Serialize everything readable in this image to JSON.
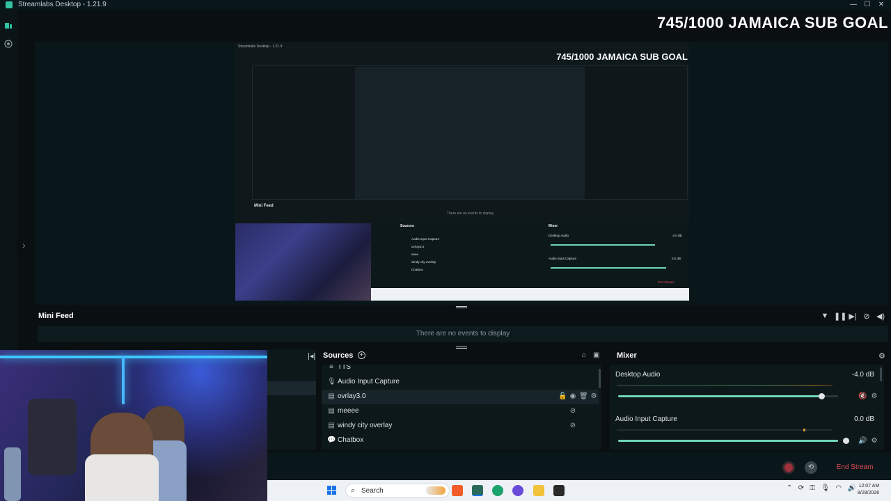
{
  "window": {
    "title": "Streamlabs Desktop - 1.21.9",
    "minimize": "—",
    "maximize": "☐",
    "close": "✕"
  },
  "overlay": {
    "goal_text": "745/1000 JAMAICA SUB GOAL"
  },
  "inner_preview": {
    "title": "Streamlabs Desktop - 1.21.9",
    "goal_text": "745/1000 JAMAICA SUB GOAL",
    "mini_feed_title": "Mini Feed",
    "mini_feed_empty": "There are no events to display",
    "sources_title": "Sources",
    "mixer_title": "Mixer",
    "sources": [
      "Audio Input Capture",
      "ovrlay3.0",
      "eeee",
      "windy city overlay",
      "Chatbox"
    ],
    "mixer": [
      {
        "name": "Desktop Audio",
        "db": "-4.0 dB"
      },
      {
        "name": "Audio Input Capture",
        "db": "0.0 dB"
      }
    ],
    "end_stream": "End Stream"
  },
  "mini_feed": {
    "title": "Mini Feed",
    "empty_text": "There are no events to display",
    "icons": [
      "filter-icon",
      "pause-icon",
      "skip-icon",
      "mute-alerts-icon",
      "volume-icon"
    ]
  },
  "sources": {
    "title": "Sources",
    "items": [
      {
        "label": "TTS",
        "icon": "text-icon"
      },
      {
        "label": "Audio Input Capture",
        "icon": "microphone-icon"
      },
      {
        "label": "ovrlay3.0",
        "icon": "browser-source-icon"
      },
      {
        "label": "meeee",
        "icon": "browser-source-icon"
      },
      {
        "label": "windy city overlay",
        "icon": "browser-source-icon"
      },
      {
        "label": "Chatbox",
        "icon": "chat-icon"
      }
    ]
  },
  "mixer": {
    "title": "Mixer",
    "channels": [
      {
        "name": "Desktop Audio",
        "db": "-4.0 dB",
        "level": 0.92
      },
      {
        "name": "Audio Input Capture",
        "db": "0.0 dB",
        "level": 1.0
      }
    ]
  },
  "controls": {
    "end_stream": "End Stream"
  },
  "taskbar": {
    "search_placeholder": "Search",
    "time": "12:07 AM",
    "date": "8/28/2026"
  },
  "colors": {
    "accent": "#31c3a2",
    "end_stream": "#e24b55",
    "panel": "#0d181b",
    "background": "#09161a"
  }
}
